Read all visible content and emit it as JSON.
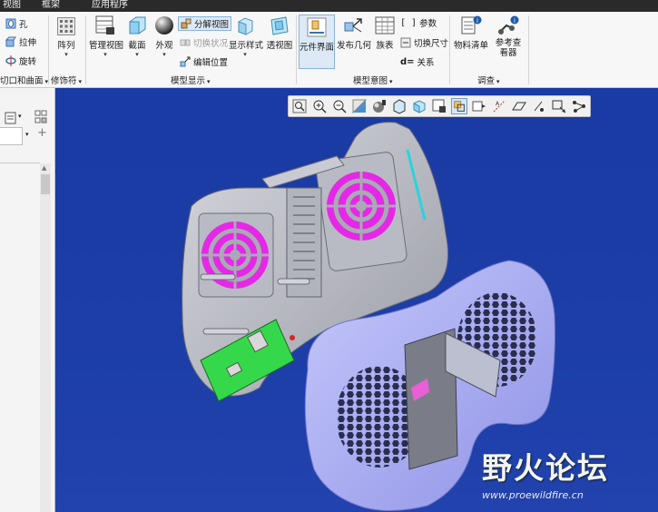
{
  "menu": {
    "items": [
      "视图",
      "框架",
      "应用程序"
    ]
  },
  "ribbon": {
    "cut": {
      "hole": "孔",
      "extrude": "拉伸",
      "revolve": "旋转",
      "group_label": "切口和曲面"
    },
    "modifiers": {
      "pattern": "阵列",
      "group_label": "修饰符"
    },
    "model_display": {
      "manage_views": "管理视图",
      "section": "截面",
      "appearance": "外观",
      "explode_view": "分解视图",
      "toggle_status": "切换状况",
      "edit_position": "编辑位置",
      "display_style": "显示样式",
      "perspective": "透视图",
      "group_label": "模型显示"
    },
    "model_intent": {
      "component_interface": "元件界面",
      "publish_geometry": "发布几何",
      "family_table": "族表",
      "parameters": "参数",
      "switch_dimensions": "切换尺寸",
      "relations": "关系",
      "group_label": "模型意图"
    },
    "investigate": {
      "bill_of_materials": "物料清单",
      "reference_viewer": "参考查看器",
      "group_label": "调查"
    }
  },
  "watermark": {
    "title": "野火论坛",
    "url": "www.proewildfire.cn"
  },
  "colors": {
    "viewport_bg": "#1d3a9c",
    "fan_magenta": "#e428e6",
    "pcb_green": "#35d84a",
    "shell_lavender": "#a9acf0"
  }
}
